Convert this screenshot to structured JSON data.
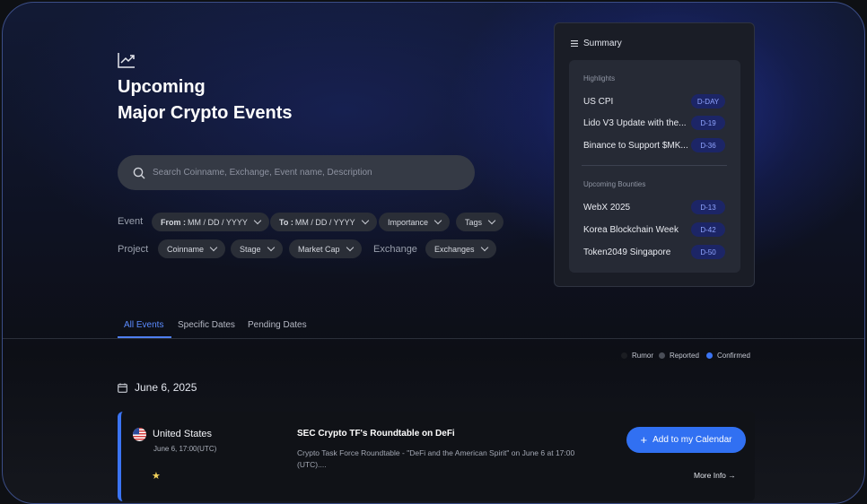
{
  "header": {
    "title_line1": "Upcoming",
    "title_line2": "Major Crypto Events"
  },
  "search": {
    "placeholder": "Search Coinname, Exchange, Event name, Description"
  },
  "filters": {
    "event_label": "Event",
    "project_label": "Project",
    "exchange_label": "Exchange",
    "from_key": "From :",
    "from_value": "MM / DD / YYYY",
    "to_key": "To :",
    "to_value": "MM / DD / YYYY",
    "importance": "Importance",
    "tags": "Tags",
    "coinname": "Coinname",
    "stage": "Stage",
    "market_cap": "Market Cap",
    "exchanges": "Exchanges"
  },
  "summary": {
    "title": "Summary",
    "highlights_title": "Highlights",
    "highlights": [
      {
        "name": "US CPI",
        "badge": "D-DAY"
      },
      {
        "name": "Lido V3 Update with the...",
        "badge": "D-19"
      },
      {
        "name": "Binance to Support $MK...",
        "badge": "D-36"
      }
    ],
    "bounties_title": "Upcoming Bounties",
    "bounties": [
      {
        "name": "WebX 2025",
        "badge": "D-13"
      },
      {
        "name": "Korea Blockchain Week",
        "badge": "D-42"
      },
      {
        "name": "Token2049 Singapore",
        "badge": "D-50"
      }
    ]
  },
  "tabs": [
    {
      "label": "All Events"
    },
    {
      "label": "Specific Dates"
    },
    {
      "label": "Pending Dates"
    }
  ],
  "legend": [
    {
      "label": "Rumor",
      "color": "#1b1d22"
    },
    {
      "label": "Reported",
      "color": "#4a4e58"
    },
    {
      "label": "Confirmed",
      "color": "#3b74f3"
    }
  ],
  "date_heading": "June 6, 2025",
  "event": {
    "country": "United States",
    "datetime": "June 6, 17:00(UTC)",
    "star": "★",
    "title": "SEC Crypto TF's Roundtable on DeFi",
    "description": "Crypto Task Force Roundtable - \"DeFi and the American Spirit\" on June 6 at 17:00 (UTC)....",
    "calendar_button": "Add to my Calendar",
    "more_info": "More Info →"
  },
  "colors": {
    "accent": "#3170f2",
    "badge_bg": "#1c2566",
    "badge_text": "#8fa4ff"
  }
}
